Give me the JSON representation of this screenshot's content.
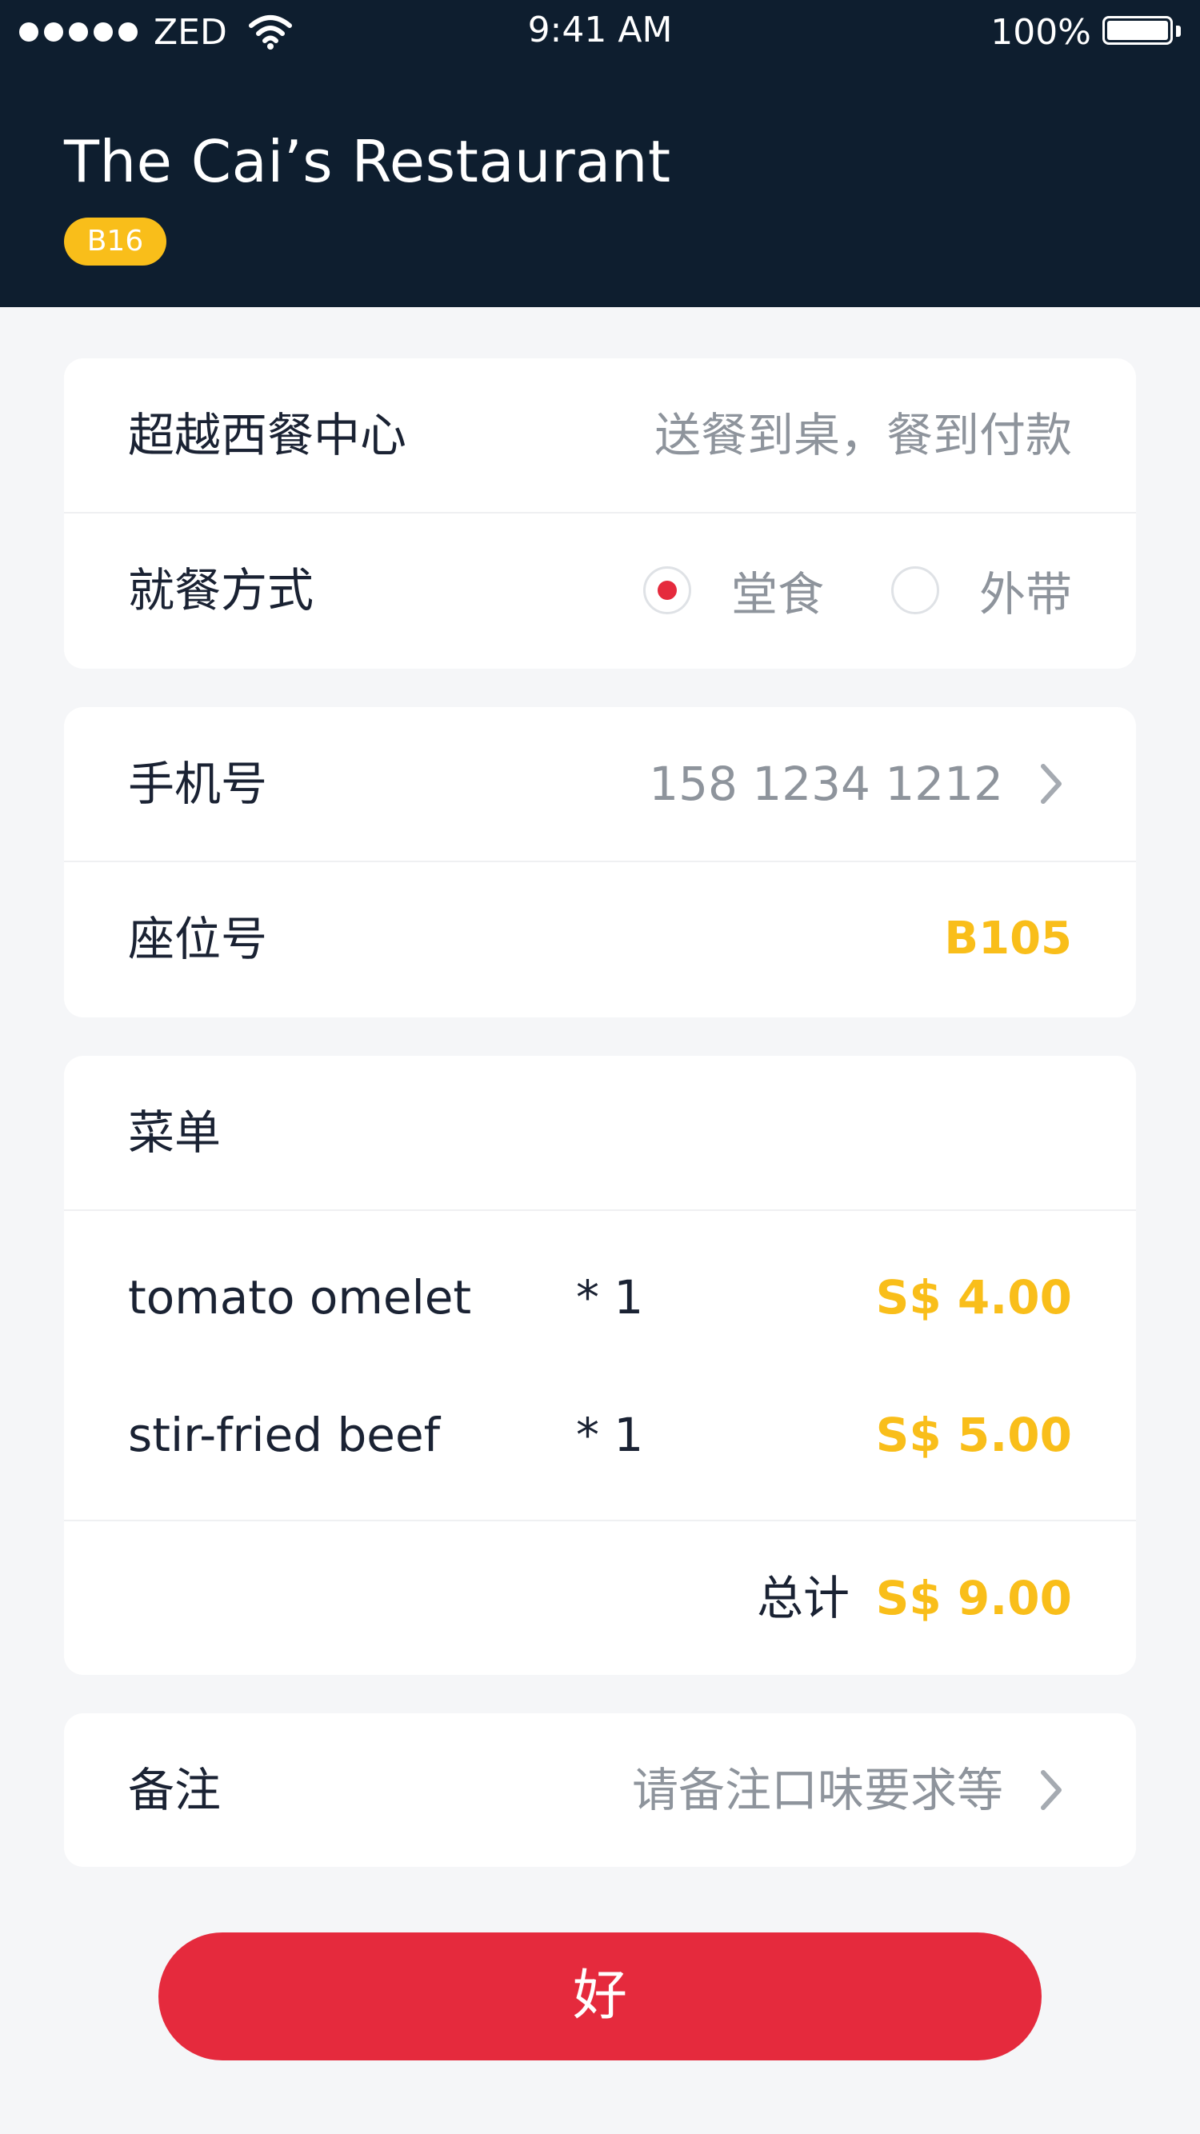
{
  "status_bar": {
    "carrier": "ZED",
    "time": "9:41 AM",
    "battery": "100%",
    "signal_dots": 5,
    "icons": [
      "signal-dots-icon",
      "wifi-icon",
      "battery-icon"
    ]
  },
  "header": {
    "title": "The Cai’s Restaurant",
    "badge": "B16"
  },
  "restaurant_card": {
    "name": "超越西餐中心",
    "service_note": "送餐到桌，餐到付款",
    "dining_label": "就餐方式",
    "dining_options": [
      {
        "label": "堂食",
        "selected": true
      },
      {
        "label": "外带",
        "selected": false
      }
    ]
  },
  "contact_card": {
    "phone_label": "手机号",
    "phone_value": "158 1234 1212",
    "seat_label": "座位号",
    "seat_value": "B105"
  },
  "menu_card": {
    "title": "菜单",
    "items": [
      {
        "name": "tomato omelet",
        "qty": "* 1",
        "price": "S$ 4.00"
      },
      {
        "name": "stir-fried beef",
        "qty": "* 1",
        "price": "S$ 5.00"
      }
    ],
    "total_label": "总计",
    "total_value": "S$ 9.00"
  },
  "notes_card": {
    "label": "备注",
    "placeholder": "请备注口味要求等"
  },
  "confirm_button": {
    "label": "好"
  },
  "colors": {
    "header_bg": "#0e1e2f",
    "accent_yellow": "#f9be1a",
    "accent_red": "#e52a3d",
    "page_bg": "#f5f6f8",
    "muted_text": "#8e949c"
  }
}
